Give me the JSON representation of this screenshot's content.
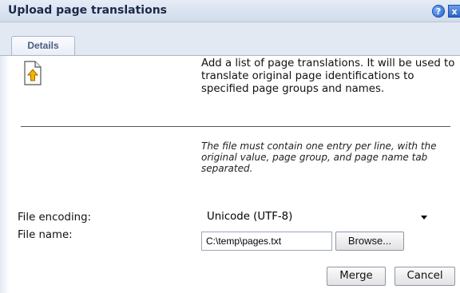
{
  "dialog": {
    "title": "Upload page translations",
    "help_label": "?",
    "close_label": "x"
  },
  "tabs": [
    {
      "label": "Details",
      "selected": true
    }
  ],
  "content": {
    "icon": "file-upload-icon",
    "intro": "Add a list of page translations. It will be used to translate original page identifications to specified page groups and names.",
    "note": "The file must contain one entry per line, with the original value, page group, and page name tab separated."
  },
  "form": {
    "encoding_label": "File encoding:",
    "encoding_value": "Unicode (UTF-8)",
    "filename_label": "File name:",
    "filename_value": "C:\\temp\\pages.txt",
    "browse_label": "Browse..."
  },
  "actions": {
    "merge_label": "Merge",
    "cancel_label": "Cancel"
  }
}
